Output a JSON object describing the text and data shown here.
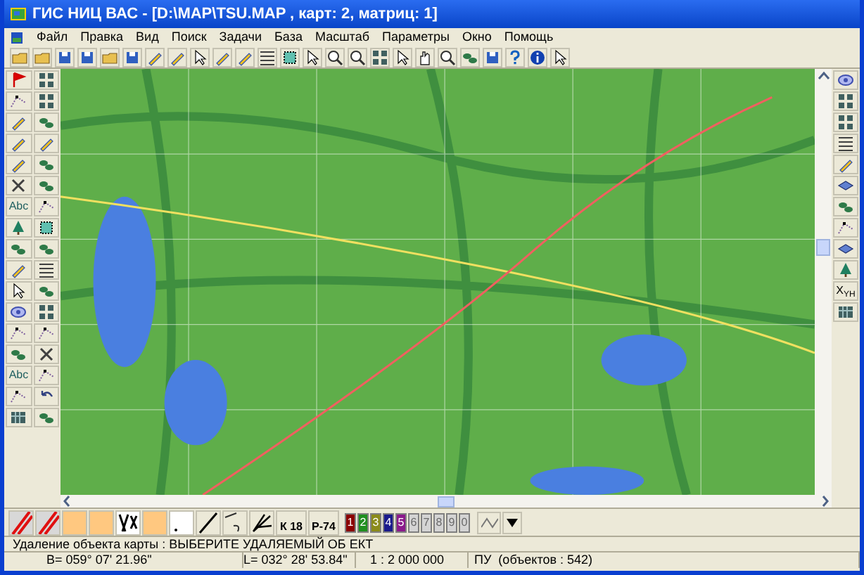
{
  "window": {
    "title": "ГИС НИЦ ВАС - [D:\\MAP\\TSU.MAP , карт: 2, матриц: 1]"
  },
  "menu": [
    "Файл",
    "Правка",
    "Вид",
    "Поиск",
    "Задачи",
    "База",
    "Масштаб",
    "Параметры",
    "Окно",
    "Помощь"
  ],
  "left_toolbar": {
    "text_buttons": [
      "Abc",
      "Abc"
    ]
  },
  "right_toolbar": {
    "coordinates_button": "X$_{YH}$"
  },
  "bottom_toolbar": [
    {
      "kind": "hatch"
    },
    {
      "kind": "hatch"
    },
    {
      "kind": "fill"
    },
    {
      "kind": "fill"
    },
    {
      "kind": "pattern"
    },
    {
      "kind": "fill"
    },
    {
      "kind": "point"
    },
    {
      "kind": "line"
    },
    {
      "kind": "curve"
    },
    {
      "kind": "branch"
    },
    {
      "kind": "sign",
      "label": "К 18"
    },
    {
      "kind": "sign",
      "label": "Р-74"
    }
  ],
  "layers": [
    {
      "label": "1",
      "color": "#8b0000",
      "disabled": false
    },
    {
      "label": "2",
      "color": "#1f8f1f",
      "disabled": false
    },
    {
      "label": "3",
      "color": "#8b8b1a",
      "disabled": false
    },
    {
      "label": "4",
      "color": "#1a1a8b",
      "disabled": false
    },
    {
      "label": "5",
      "color": "#8b1a8b",
      "disabled": false
    },
    {
      "label": "6",
      "disabled": true
    },
    {
      "label": "7",
      "disabled": true
    },
    {
      "label": "8",
      "disabled": true
    },
    {
      "label": "9",
      "disabled": true
    },
    {
      "label": "0",
      "disabled": true
    }
  ],
  "status_message": "Удаление объекта карты : ВЫБЕРИТЕ УДАЛЯЕМЫЙ ОБ ЕКТ",
  "status_bar": [
    "B= 059° 07' 21.96\"",
    "L= 032° 28' 53.84\"",
    "1 : 2 000 000",
    "ПУ  (объектов : 542)"
  ]
}
